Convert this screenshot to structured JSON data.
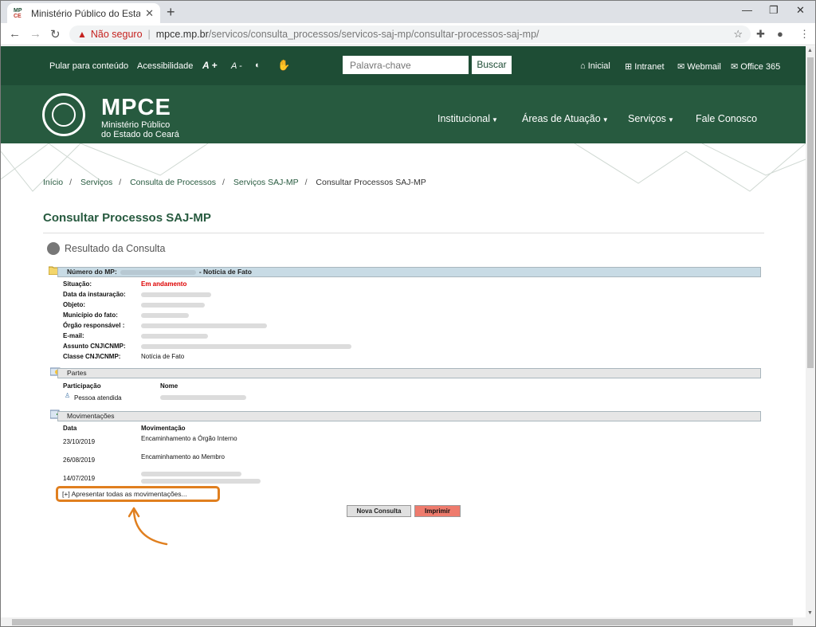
{
  "browser": {
    "tab_title": "Ministério Público do Estado do",
    "favicon_text": [
      "MP",
      "CE"
    ],
    "not_secure": "Não seguro",
    "url_host": "mpce.mp.br",
    "url_path": "/servicos/consulta_processos/servicos-saj-mp/consultar-processos-saj-mp/"
  },
  "topbar": {
    "skip": "Pular para conteúdo",
    "accessibility": "Acessibilidade",
    "font_plus": "A +",
    "font_minus": "A -",
    "search_placeholder": "Palavra-chave",
    "search_btn": "Buscar",
    "links": [
      "Inicial",
      "Intranet",
      "Webmail",
      "Office 365"
    ]
  },
  "logo": {
    "name": "MPCE",
    "line1": "Ministério Público",
    "line2": "do Estado do Ceará"
  },
  "mainnav": [
    "Institucional",
    "Áreas de Atuação",
    "Serviços",
    "Fale Conosco"
  ],
  "breadcrumb": [
    "Início",
    "Serviços",
    "Consulta de Processos",
    "Serviços SAJ-MP",
    "Consultar Processos SAJ-MP"
  ],
  "page_title": "Consultar Processos SAJ-MP",
  "result_title": "Resultado da Consulta",
  "process": {
    "header_label": "Número do MP:",
    "header_suffix": "- Notícia de Fato",
    "fields": [
      {
        "label": "Situação:",
        "value": "Em andamento"
      },
      {
        "label": "Data da instauração:",
        "value": ""
      },
      {
        "label": "Objeto:",
        "value": ""
      },
      {
        "label": "Município do fato:",
        "value": ""
      },
      {
        "label": "Órgão responsável :",
        "value": ""
      },
      {
        "label": "E-mail:",
        "value": ""
      },
      {
        "label": "Assunto CNJ\\CNMP:",
        "value": ""
      },
      {
        "label": "Classe CNJ\\CNMP:",
        "value": "Notícia de Fato"
      }
    ]
  },
  "partes": {
    "title": "Partes",
    "col1": "Participação",
    "col2": "Nome",
    "row_role": "Pessoa atendida"
  },
  "movimentacoes": {
    "title": "Movimentações",
    "col1": "Data",
    "col2": "Movimentação",
    "rows": [
      {
        "date": "23/10/2019",
        "text": "Encaminhamento a Órgão Interno"
      },
      {
        "date": "26/08/2019",
        "text": "Encaminhamento ao Membro"
      },
      {
        "date": "14/07/2019",
        "text": ""
      }
    ],
    "show_all": "[+] Apresentar todas as movimentações..."
  },
  "buttons": {
    "new_query": "Nova Consulta",
    "print": "Imprimir"
  },
  "colors": {
    "brand_green": "#1e4d35",
    "highlight_orange": "#e07f1f",
    "status_red": "#dd0000"
  }
}
